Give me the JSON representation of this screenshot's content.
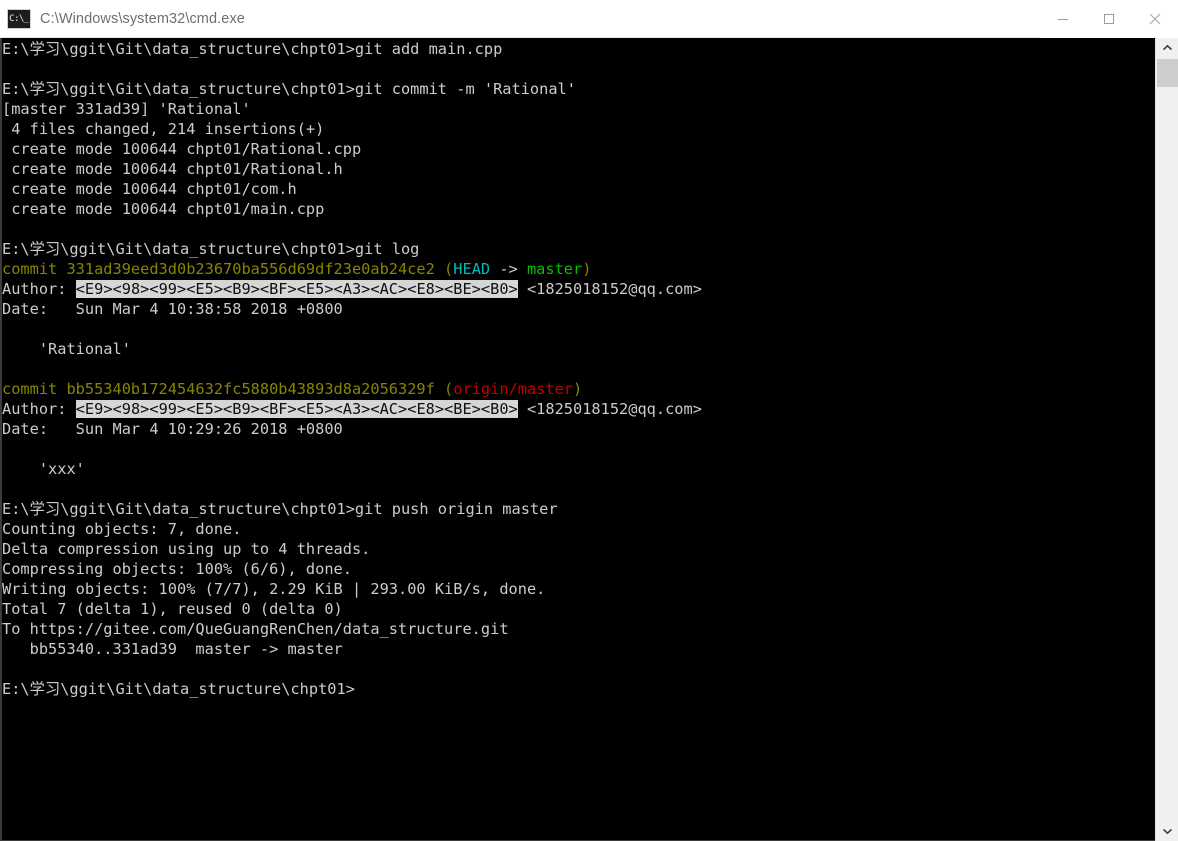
{
  "window": {
    "title": "C:\\Windows\\system32\\cmd.exe",
    "icon": "cmd-icon",
    "icon_glyph": "C:\\_",
    "controls": {
      "minimize": "minimize-button",
      "maximize": "maximize-button",
      "close": "close-button"
    }
  },
  "colors": {
    "background": "#000000",
    "foreground": "#cccccc",
    "commit_yellow": "#868600",
    "branch_green": "#00c000",
    "head_cyan": "#00baba",
    "remote_red": "#c00000",
    "selection_bg": "#d6d6d6",
    "selection_fg": "#101010",
    "titlebar_bg": "#ffffff",
    "titlebar_fg": "#6f6f6f"
  },
  "terminal": {
    "prompt": "E:\\学习\\ggit\\Git\\data_structure\\chpt01>",
    "lines": [
      {
        "id": "cmd-git-add",
        "segments": [
          {
            "t": "E:\\学习\\ggit\\Git\\data_structure\\chpt01>git add main.cpp",
            "c": "white"
          }
        ]
      },
      {
        "id": "blank-1",
        "segments": []
      },
      {
        "id": "cmd-git-commit",
        "segments": [
          {
            "t": "E:\\学习\\ggit\\Git\\data_structure\\chpt01>git commit -m 'Rational'",
            "c": "white"
          }
        ]
      },
      {
        "id": "out-commit-head",
        "segments": [
          {
            "t": "[master 331ad39] 'Rational'",
            "c": "white"
          }
        ]
      },
      {
        "id": "out-files-changed",
        "segments": [
          {
            "t": " 4 files changed, 214 insertions(+)",
            "c": "white"
          }
        ]
      },
      {
        "id": "out-create-1",
        "segments": [
          {
            "t": " create mode 100644 chpt01/Rational.cpp",
            "c": "white"
          }
        ]
      },
      {
        "id": "out-create-2",
        "segments": [
          {
            "t": " create mode 100644 chpt01/Rational.h",
            "c": "white"
          }
        ]
      },
      {
        "id": "out-create-3",
        "segments": [
          {
            "t": " create mode 100644 chpt01/com.h",
            "c": "white"
          }
        ]
      },
      {
        "id": "out-create-4",
        "segments": [
          {
            "t": " create mode 100644 chpt01/main.cpp",
            "c": "white"
          }
        ]
      },
      {
        "id": "blank-2",
        "segments": []
      },
      {
        "id": "cmd-git-log",
        "segments": [
          {
            "t": "E:\\学习\\ggit\\Git\\data_structure\\chpt01>git log",
            "c": "white"
          }
        ]
      },
      {
        "id": "log1-commit",
        "segments": [
          {
            "t": "commit 331ad39eed3d0b23670ba556d69df23e0ab24ce2 (",
            "c": "yellow"
          },
          {
            "t": "HEAD",
            "c": "cyan"
          },
          {
            "t": " -> ",
            "c": "white"
          },
          {
            "t": "master",
            "c": "green"
          },
          {
            "t": ")",
            "c": "yellow"
          }
        ]
      },
      {
        "id": "log1-author",
        "segments": [
          {
            "t": "Author: ",
            "c": "white"
          },
          {
            "t": "<E9><98><99><E5><B9><BF><E5><A3><AC><E8><BE><B0>",
            "c": "inv"
          },
          {
            "t": " <1825018152@qq.com>",
            "c": "white"
          }
        ]
      },
      {
        "id": "log1-date",
        "segments": [
          {
            "t": "Date:   Sun Mar 4 10:38:58 2018 +0800",
            "c": "white"
          }
        ]
      },
      {
        "id": "blank-3",
        "segments": []
      },
      {
        "id": "log1-message",
        "segments": [
          {
            "t": "    'Rational'",
            "c": "white"
          }
        ]
      },
      {
        "id": "blank-4",
        "segments": []
      },
      {
        "id": "log2-commit",
        "segments": [
          {
            "t": "commit bb55340b172454632fc5880b43893d8a2056329f (",
            "c": "yellow"
          },
          {
            "t": "origin/master",
            "c": "red"
          },
          {
            "t": ")",
            "c": "yellow"
          }
        ]
      },
      {
        "id": "log2-author",
        "segments": [
          {
            "t": "Author: ",
            "c": "white"
          },
          {
            "t": "<E9><98><99><E5><B9><BF><E5><A3><AC><E8><BE><B0>",
            "c": "inv"
          },
          {
            "t": " <1825018152@qq.com>",
            "c": "white"
          }
        ]
      },
      {
        "id": "log2-date",
        "segments": [
          {
            "t": "Date:   Sun Mar 4 10:29:26 2018 +0800",
            "c": "white"
          }
        ]
      },
      {
        "id": "blank-5",
        "segments": []
      },
      {
        "id": "log2-message",
        "segments": [
          {
            "t": "    'xxx'",
            "c": "white"
          }
        ]
      },
      {
        "id": "blank-6",
        "segments": []
      },
      {
        "id": "cmd-git-push",
        "segments": [
          {
            "t": "E:\\学习\\ggit\\Git\\data_structure\\chpt01>git push origin master",
            "c": "white"
          }
        ]
      },
      {
        "id": "push-counting",
        "segments": [
          {
            "t": "Counting objects: 7, done.",
            "c": "white"
          }
        ]
      },
      {
        "id": "push-delta",
        "segments": [
          {
            "t": "Delta compression using up to 4 threads.",
            "c": "white"
          }
        ]
      },
      {
        "id": "push-compressing",
        "segments": [
          {
            "t": "Compressing objects: 100% (6/6), done.",
            "c": "white"
          }
        ]
      },
      {
        "id": "push-writing",
        "segments": [
          {
            "t": "Writing objects: 100% (7/7), 2.29 KiB | 293.00 KiB/s, done.",
            "c": "white"
          }
        ]
      },
      {
        "id": "push-total",
        "segments": [
          {
            "t": "Total 7 (delta 1), reused 0 (delta 0)",
            "c": "white"
          }
        ]
      },
      {
        "id": "push-remote-url",
        "segments": [
          {
            "t": "To https://gitee.com/QueGuangRenChen/data_structure.git",
            "c": "white"
          }
        ]
      },
      {
        "id": "push-refupdate",
        "segments": [
          {
            "t": "   bb55340..331ad39  master -> master",
            "c": "white"
          }
        ]
      },
      {
        "id": "blank-7",
        "segments": []
      },
      {
        "id": "cmd-prompt-final",
        "segments": [
          {
            "t": "E:\\学习\\ggit\\Git\\data_structure\\chpt01>",
            "c": "white"
          }
        ]
      }
    ]
  },
  "scrollbar": {
    "up_arrow": "scroll-up-arrow",
    "down_arrow": "scroll-down-arrow",
    "thumb": "scrollbar-thumb"
  }
}
